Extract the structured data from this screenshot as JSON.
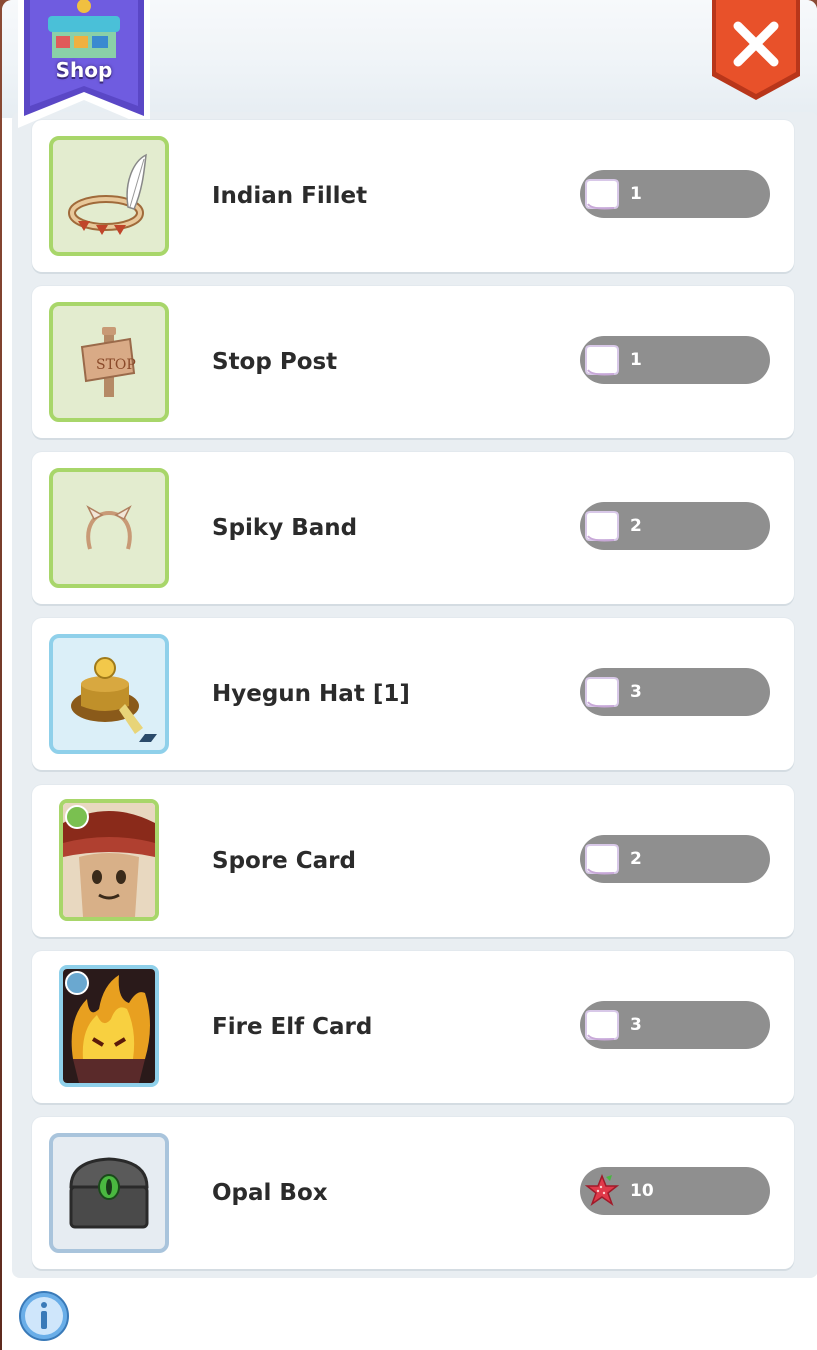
{
  "header": {
    "shop_label": "Shop",
    "shop_icon": "shop-stall-icon",
    "close_icon": "close-icon"
  },
  "items": [
    {
      "name": "Indian Fillet",
      "icon": "indian-fillet-icon",
      "price": "1",
      "currency_icon": "ticket-icon"
    },
    {
      "name": "Stop Post",
      "icon": "stop-post-icon",
      "price": "1",
      "currency_icon": "ticket-icon"
    },
    {
      "name": "Spiky Band",
      "icon": "spiky-band-icon",
      "price": "2",
      "currency_icon": "ticket-icon"
    },
    {
      "name": "Hyegun Hat [1]",
      "icon": "hyegun-hat-icon",
      "price": "3",
      "currency_icon": "ticket-icon"
    },
    {
      "name": "Spore Card",
      "icon": "spore-card-icon",
      "price": "2",
      "currency_icon": "ticket-icon"
    },
    {
      "name": "Fire Elf Card",
      "icon": "fire-elf-card-icon",
      "price": "3",
      "currency_icon": "ticket-icon"
    },
    {
      "name": "Opal Box",
      "icon": "opal-box-icon",
      "price": "10",
      "currency_icon": "strawberry-star-icon"
    }
  ],
  "footer": {
    "info_icon": "info-icon"
  },
  "colors": {
    "accent_green": "#a8d66a",
    "accent_blue": "#8fd0ea",
    "price_pill": "#8f8f8f",
    "close_red": "#e8512a",
    "ribbon_purple": "#5a47c6"
  }
}
